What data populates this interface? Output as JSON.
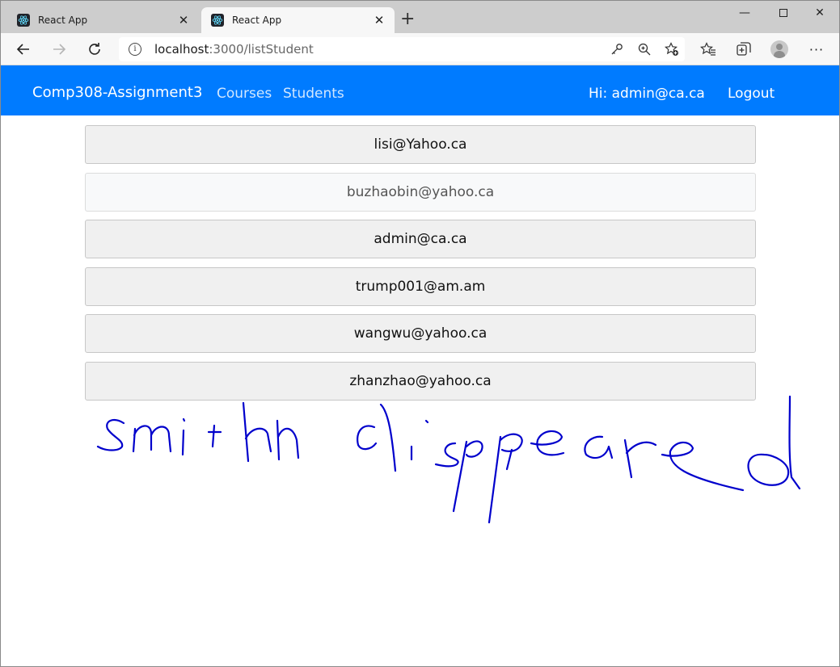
{
  "browser": {
    "tabs": [
      {
        "title": "React App",
        "active": false,
        "favicon": "react-icon"
      },
      {
        "title": "React App",
        "active": true,
        "favicon": "react-icon"
      }
    ],
    "address": {
      "host": "localhost",
      "path": ":3000/listStudent"
    }
  },
  "navbar": {
    "brand": "Comp308-Assignment3",
    "links": [
      "Courses",
      "Students"
    ],
    "user_greeting": "Hi: admin@ca.ca",
    "logout": "Logout",
    "background_color": "#007bff"
  },
  "students": [
    "lisi@Yahoo.ca",
    "buzhaobin@yahoo.ca",
    "admin@ca.ca",
    "trump001@am.am",
    "wangwu@yahoo.ca",
    "zhanzhao@yahoo.ca"
  ],
  "annotation": {
    "text": "smith dispeared",
    "color": "#0000cc"
  }
}
